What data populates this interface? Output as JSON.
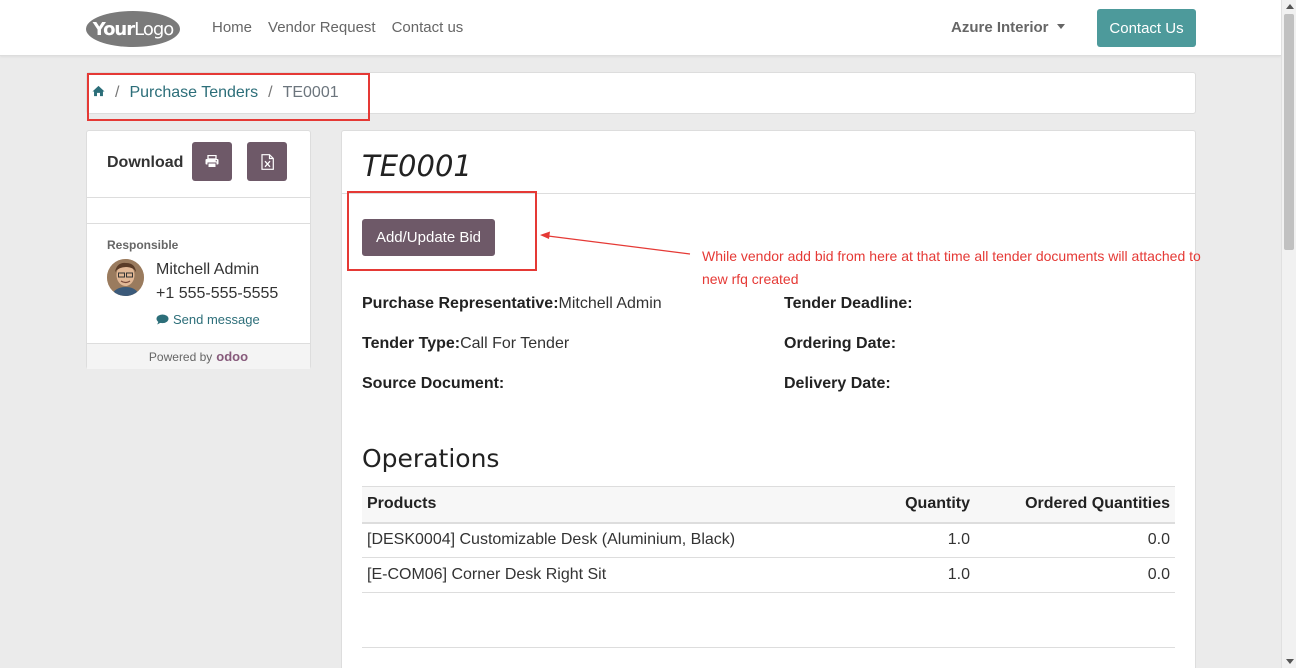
{
  "navbar": {
    "logo_text_bold": "Your",
    "logo_text_thin": "Logo",
    "links": [
      "Home",
      "Vendor Request",
      "Contact us"
    ],
    "company": "Azure Interior",
    "contact_button": "Contact Us"
  },
  "breadcrumb": {
    "separator": "/",
    "parent": "Purchase Tenders",
    "current": "TE0001"
  },
  "sidebar": {
    "download_label": "Download",
    "responsible_label": "Responsible",
    "responsible_name": "Mitchell Admin",
    "responsible_phone": "+1 555-555-5555",
    "send_message": "Send message",
    "powered_by": "Powered by",
    "powered_brand": "odoo"
  },
  "tender": {
    "title": "TE0001",
    "bid_button": "Add/Update Bid",
    "fields_left": [
      {
        "label": "Purchase Representative:",
        "value": "Mitchell Admin"
      },
      {
        "label": "Tender Type:",
        "value": "Call For Tender"
      },
      {
        "label": "Source Document:",
        "value": ""
      }
    ],
    "fields_right": [
      {
        "label": "Tender Deadline:",
        "value": ""
      },
      {
        "label": "Ordering Date:",
        "value": ""
      },
      {
        "label": "Delivery Date:",
        "value": ""
      }
    ]
  },
  "annotation": {
    "text": "While vendor add bid from here at that time all tender documents will attached to new rfq created",
    "color": "#e53935"
  },
  "operations": {
    "title": "Operations",
    "columns": [
      "Products",
      "Quantity",
      "Ordered Quantities"
    ],
    "rows": [
      {
        "product": "[DESK0004] Customizable Desk (Aluminium, Black)",
        "quantity": "1.0",
        "ordered": "0.0"
      },
      {
        "product": "[E-COM06] Corner Desk Right Sit",
        "quantity": "1.0",
        "ordered": "0.0"
      }
    ]
  },
  "colors": {
    "primary": "#4d9a9b",
    "secondary": "#6e5968",
    "link": "#2c6e79"
  },
  "icons": {
    "home": "home-icon",
    "print": "print-icon",
    "excel": "excel-file-icon",
    "message": "comment-icon",
    "caret": "caret-down-icon"
  }
}
